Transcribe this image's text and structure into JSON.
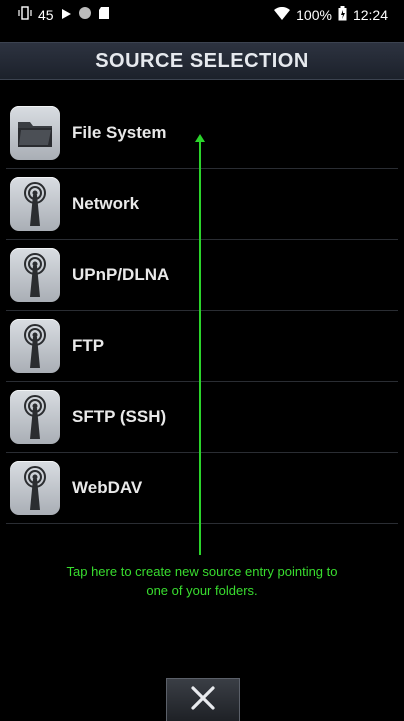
{
  "status_bar": {
    "left_text": "45",
    "battery": "100%",
    "time": "12:24"
  },
  "header": {
    "title": "SOURCE SELECTION"
  },
  "sources": [
    {
      "label": "File System",
      "icon": "folder-icon"
    },
    {
      "label": "Network",
      "icon": "antenna-icon"
    },
    {
      "label": "UPnP/DLNA",
      "icon": "antenna-icon"
    },
    {
      "label": "FTP",
      "icon": "antenna-icon"
    },
    {
      "label": "SFTP (SSH)",
      "icon": "antenna-icon"
    },
    {
      "label": "WebDAV",
      "icon": "antenna-icon"
    }
  ],
  "hint": {
    "line1": "Tap here to create new source entry pointing to",
    "line2": "one of your folders."
  },
  "colors": {
    "hint_green": "#39dd2f",
    "title_bar": "#252a34"
  }
}
